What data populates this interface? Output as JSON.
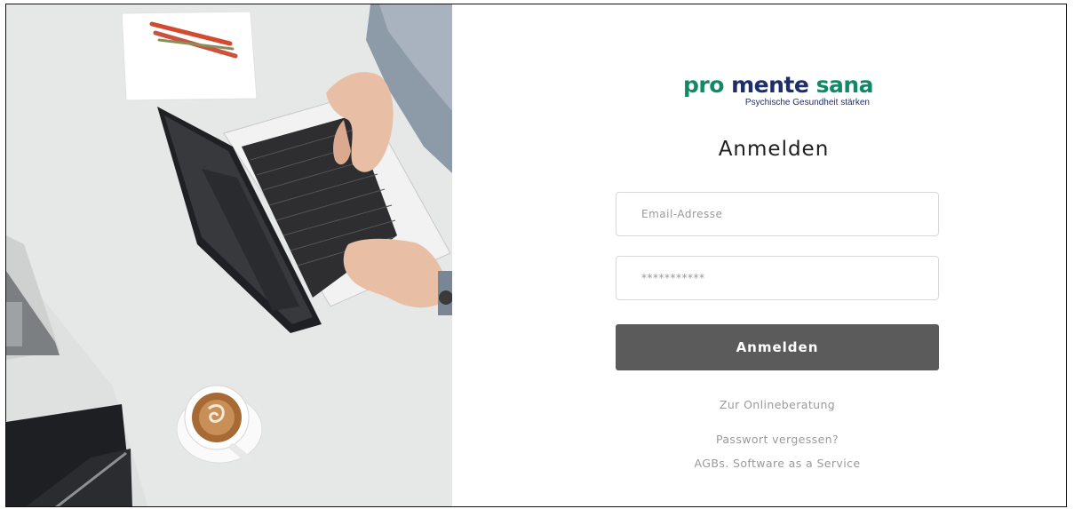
{
  "logo": {
    "pro": "pro",
    "mente": "mente",
    "sana": "sana",
    "tagline": "Psychische Gesundheit stärken",
    "colors": {
      "green": "#0f8a67",
      "navy": "#1d2f6b"
    }
  },
  "login": {
    "title": "Anmelden",
    "email_placeholder": "Email-Adresse",
    "password_placeholder": "***********",
    "submit_label": "Anmelden",
    "submit_color": "#5b5b5b"
  },
  "links": {
    "online_counseling": "Zur Onlineberatung",
    "forgot_password": "Passwort vergessen?",
    "terms": "AGBs. Software as a Service"
  },
  "hero_image": {
    "description_icons": [
      "laptop-icon",
      "coffee-cup-icon",
      "pens-icon",
      "tablet-icon",
      "notepad-icon"
    ]
  }
}
